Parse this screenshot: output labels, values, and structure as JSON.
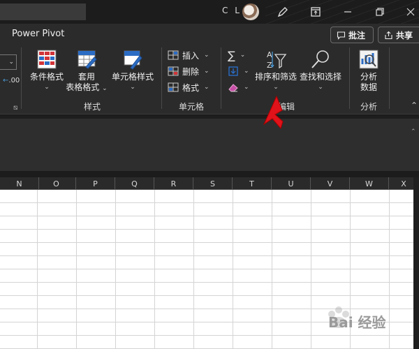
{
  "titlebar": {
    "user_initials": "C L"
  },
  "tabrow": {
    "active_tab": "Power Pivot",
    "comments_label": "批注",
    "share_label": "共享"
  },
  "ribbon": {
    "left_partial_value": ".00",
    "styles_group": {
      "label": "样式",
      "conditional_format": "条件格式",
      "format_as_table_line1": "套用",
      "format_as_table_line2": "表格格式",
      "cell_styles": "单元格样式"
    },
    "cells_group": {
      "label": "单元格",
      "insert": "插入",
      "delete": "删除",
      "format": "格式"
    },
    "editing_group": {
      "label_partial": "编辑",
      "sort_filter": "排序和筛选",
      "find_select": "查找和选择"
    },
    "analysis_group": {
      "label": "分析",
      "analyze_line1": "分析",
      "analyze_line2": "数据"
    }
  },
  "grid": {
    "columns": [
      "N",
      "O",
      "P",
      "Q",
      "R",
      "S",
      "T",
      "U",
      "V",
      "W",
      "X"
    ]
  },
  "watermark": {
    "text": "Bai 经验"
  },
  "colors": {
    "annotation_arrow": "#e0121a",
    "ribbon_bg": "#2b2b2b",
    "sheet_bg": "#ffffff"
  }
}
